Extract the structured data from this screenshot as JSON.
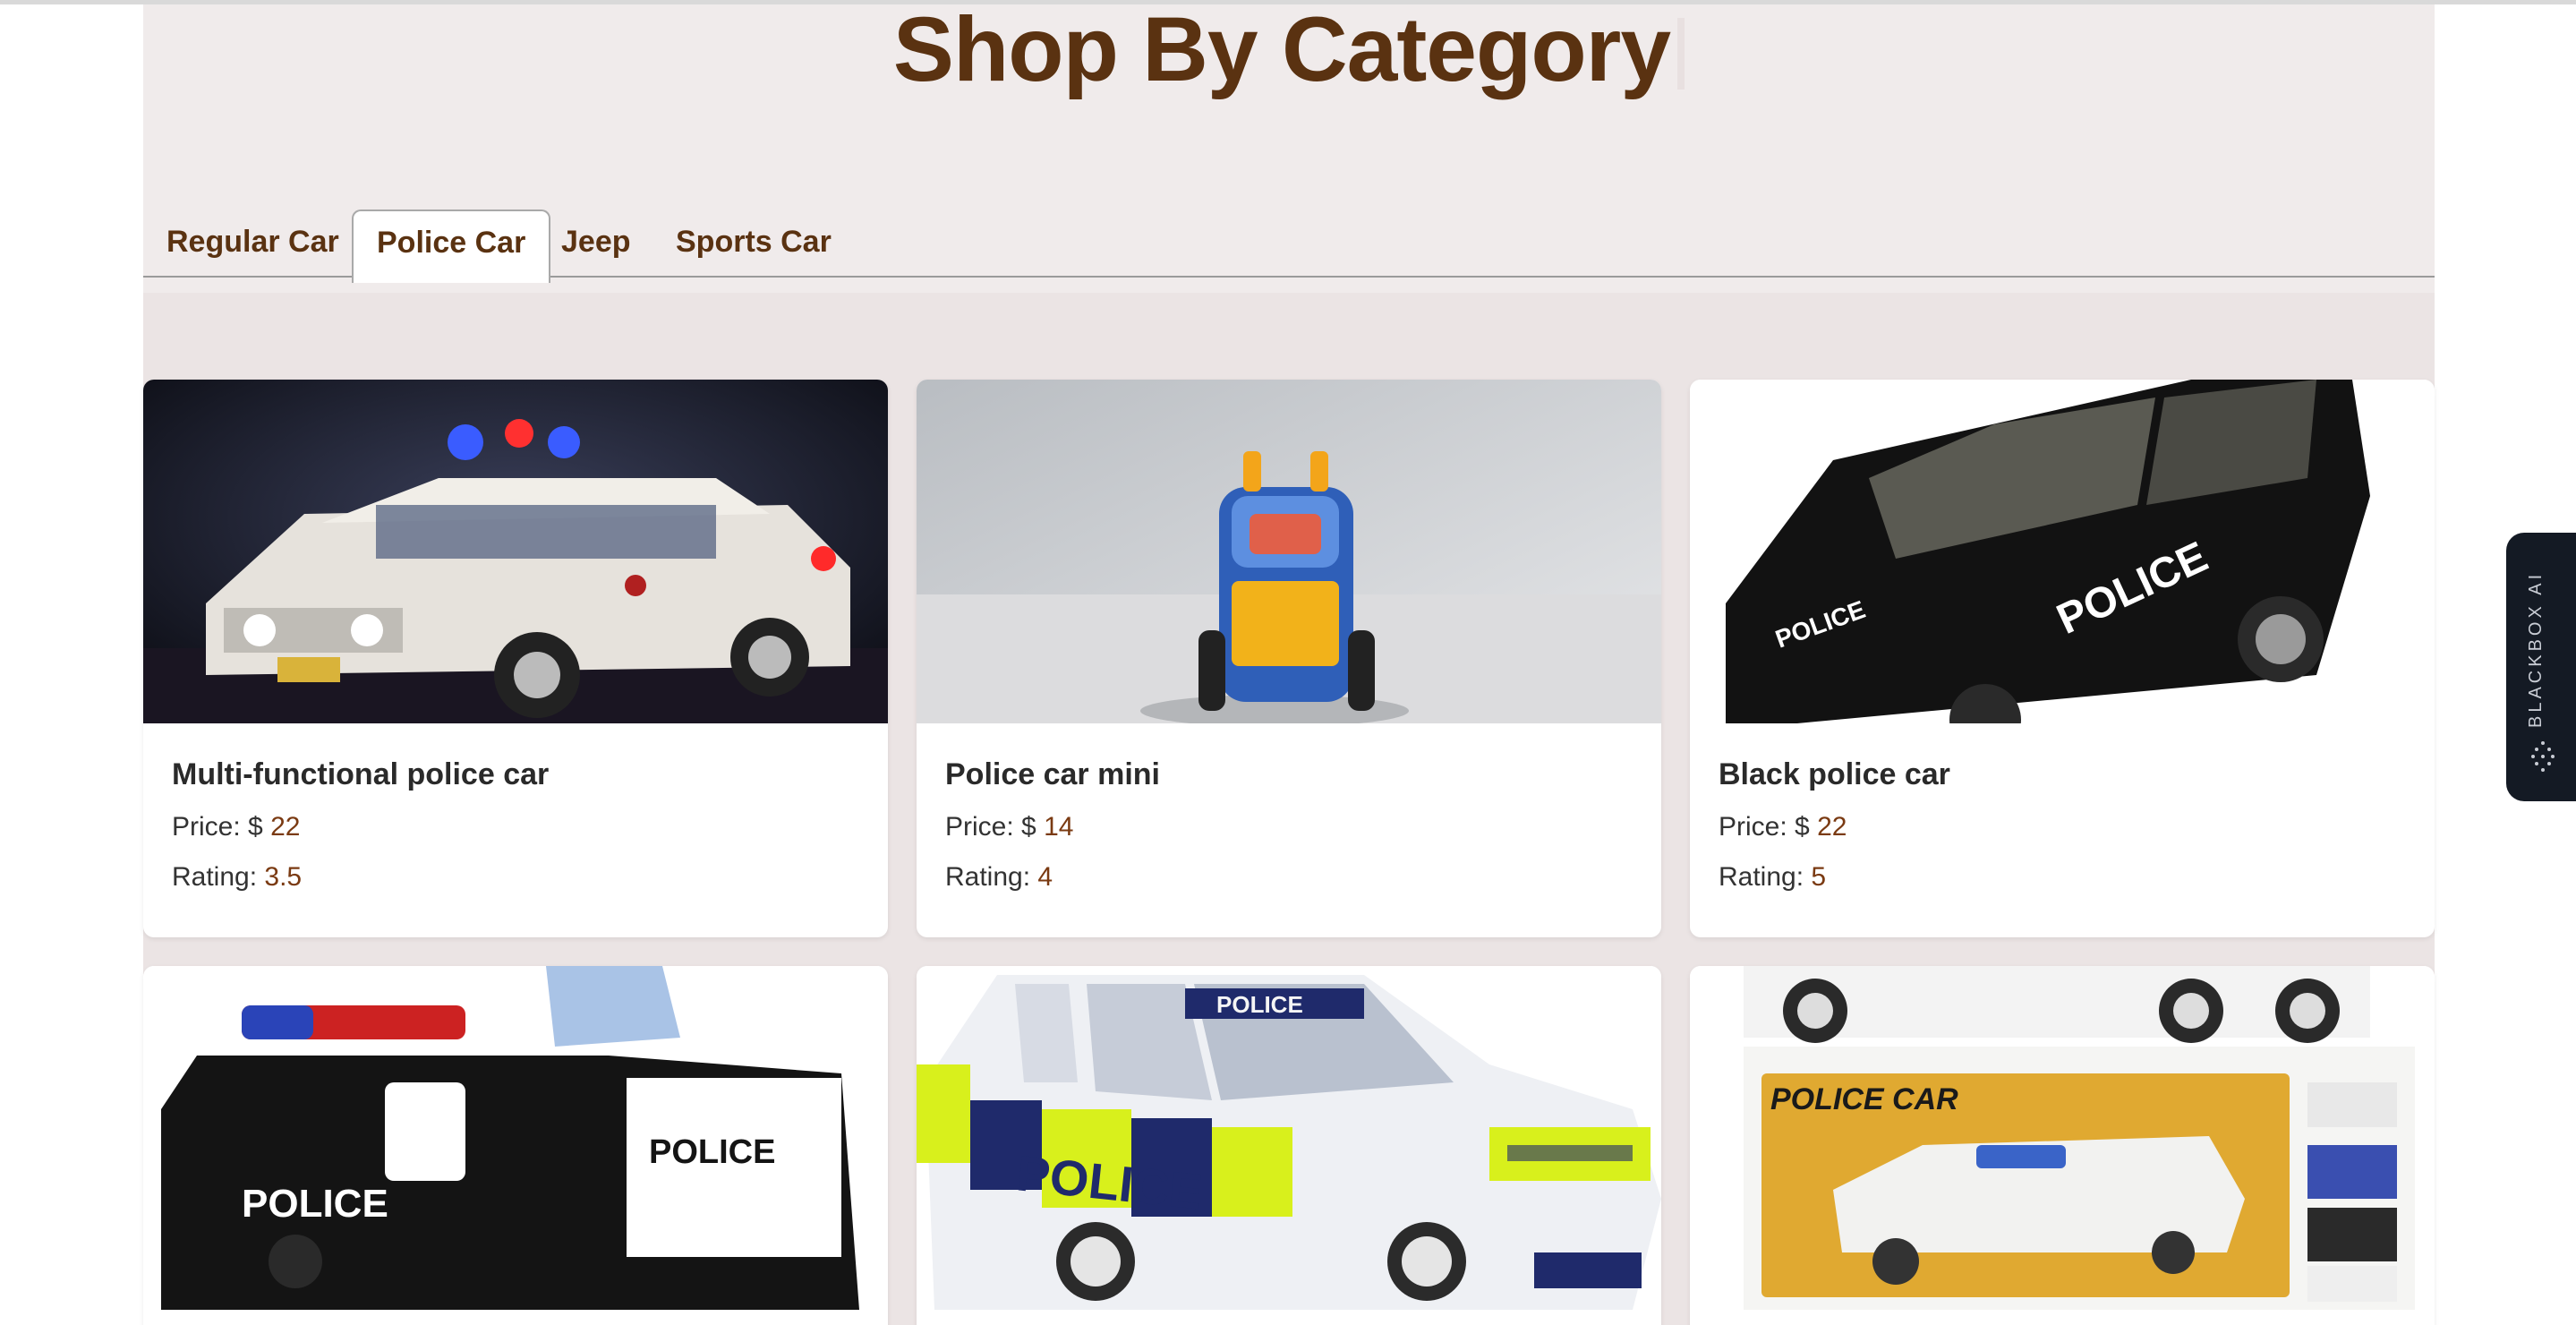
{
  "page": {
    "title": "Shop By Category"
  },
  "tabs": [
    {
      "label": "Regular Car",
      "active": false
    },
    {
      "label": "Police Car",
      "active": true
    },
    {
      "label": "Jeep",
      "active": false
    },
    {
      "label": "Sports Car",
      "active": false
    }
  ],
  "products": [
    {
      "name": "Multi-functional police car",
      "price_label": "Price: $",
      "price": "22",
      "rating_label": "Rating:",
      "rating": "3.5",
      "image": "lego-ghostbusters-ecto-1-car"
    },
    {
      "name": "Police car mini",
      "price_label": "Price: $",
      "price": "14",
      "rating_label": "Rating:",
      "rating": "4",
      "image": "blue-cartoon-toy-police-car"
    },
    {
      "name": "Black police car",
      "price_label": "Price: $",
      "price": "22",
      "rating_label": "Rating:",
      "rating": "5",
      "image": "black-police-suv-model"
    },
    {
      "name": "",
      "image": "black-white-ride-on-police-car"
    },
    {
      "name": "",
      "image": "yellow-blue-checkered-police-sedan"
    },
    {
      "name": "",
      "image": "white-police-hummer-in-box"
    }
  ],
  "sidebar_widget": {
    "label": "BLACKBOX AI"
  },
  "colors": {
    "accent_brown": "#5a3211",
    "background": "#ede7e7",
    "widget_bg": "#141a24"
  }
}
